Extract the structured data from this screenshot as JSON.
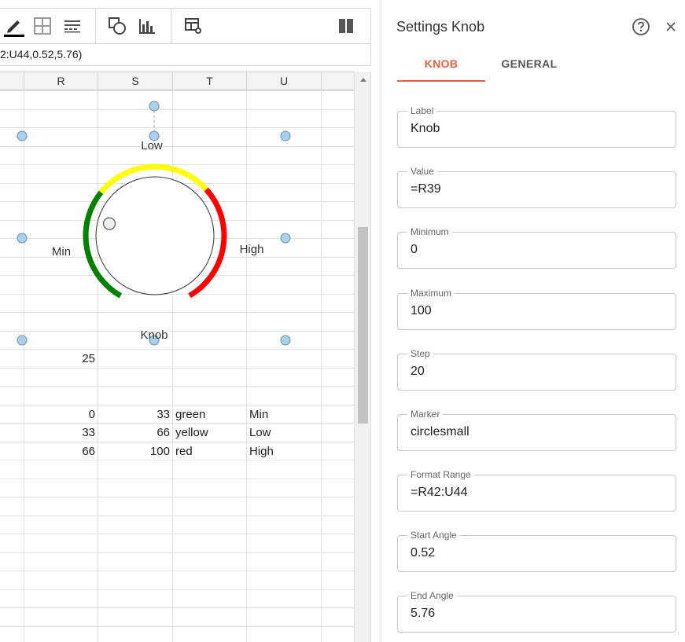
{
  "formula_bar": {
    "text": "2:U44,0.52,5.76)"
  },
  "columns": [
    "R",
    "S",
    "T",
    "U"
  ],
  "cells": {
    "r39": "25",
    "rows": [
      {
        "r": "0",
        "s": "33",
        "t": "green",
        "u": "Min"
      },
      {
        "r": "33",
        "s": "66",
        "t": "yellow",
        "u": "Low"
      },
      {
        "r": "66",
        "s": "100",
        "t": "red",
        "u": "High"
      }
    ]
  },
  "knob": {
    "label": "Knob",
    "range_labels": [
      "Min",
      "Low",
      "High"
    ],
    "value": 25,
    "min": 0,
    "max": 100,
    "start_angle": 0.52,
    "end_angle": 5.76,
    "bands": [
      {
        "from": 0,
        "to": 33,
        "color": "#008000"
      },
      {
        "from": 33,
        "to": 66,
        "color": "#ffff00"
      },
      {
        "from": 66,
        "to": 100,
        "color": "#ff0000"
      }
    ]
  },
  "panel": {
    "title": "Settings Knob",
    "tabs": [
      "KNOB",
      "GENERAL"
    ],
    "fields": [
      {
        "label": "Label",
        "value": "Knob"
      },
      {
        "label": "Value",
        "value": "=R39"
      },
      {
        "label": "Minimum",
        "value": "0"
      },
      {
        "label": "Maximum",
        "value": "100"
      },
      {
        "label": "Step",
        "value": "20"
      },
      {
        "label": "Marker",
        "value": "circlesmall"
      },
      {
        "label": "Format Range",
        "value": "=R42:U44"
      },
      {
        "label": "Start Angle",
        "value": "0.52"
      },
      {
        "label": "End Angle",
        "value": "5.76"
      }
    ]
  },
  "icons": {
    "toolbar": [
      "pencil-icon",
      "borders-icon",
      "format-icon",
      "shapes-icon",
      "bar-chart-icon",
      "table-settings-icon",
      "columns-icon"
    ],
    "panel": [
      "help-icon",
      "close-icon"
    ]
  },
  "colors": {
    "accent": "#e8623c"
  }
}
